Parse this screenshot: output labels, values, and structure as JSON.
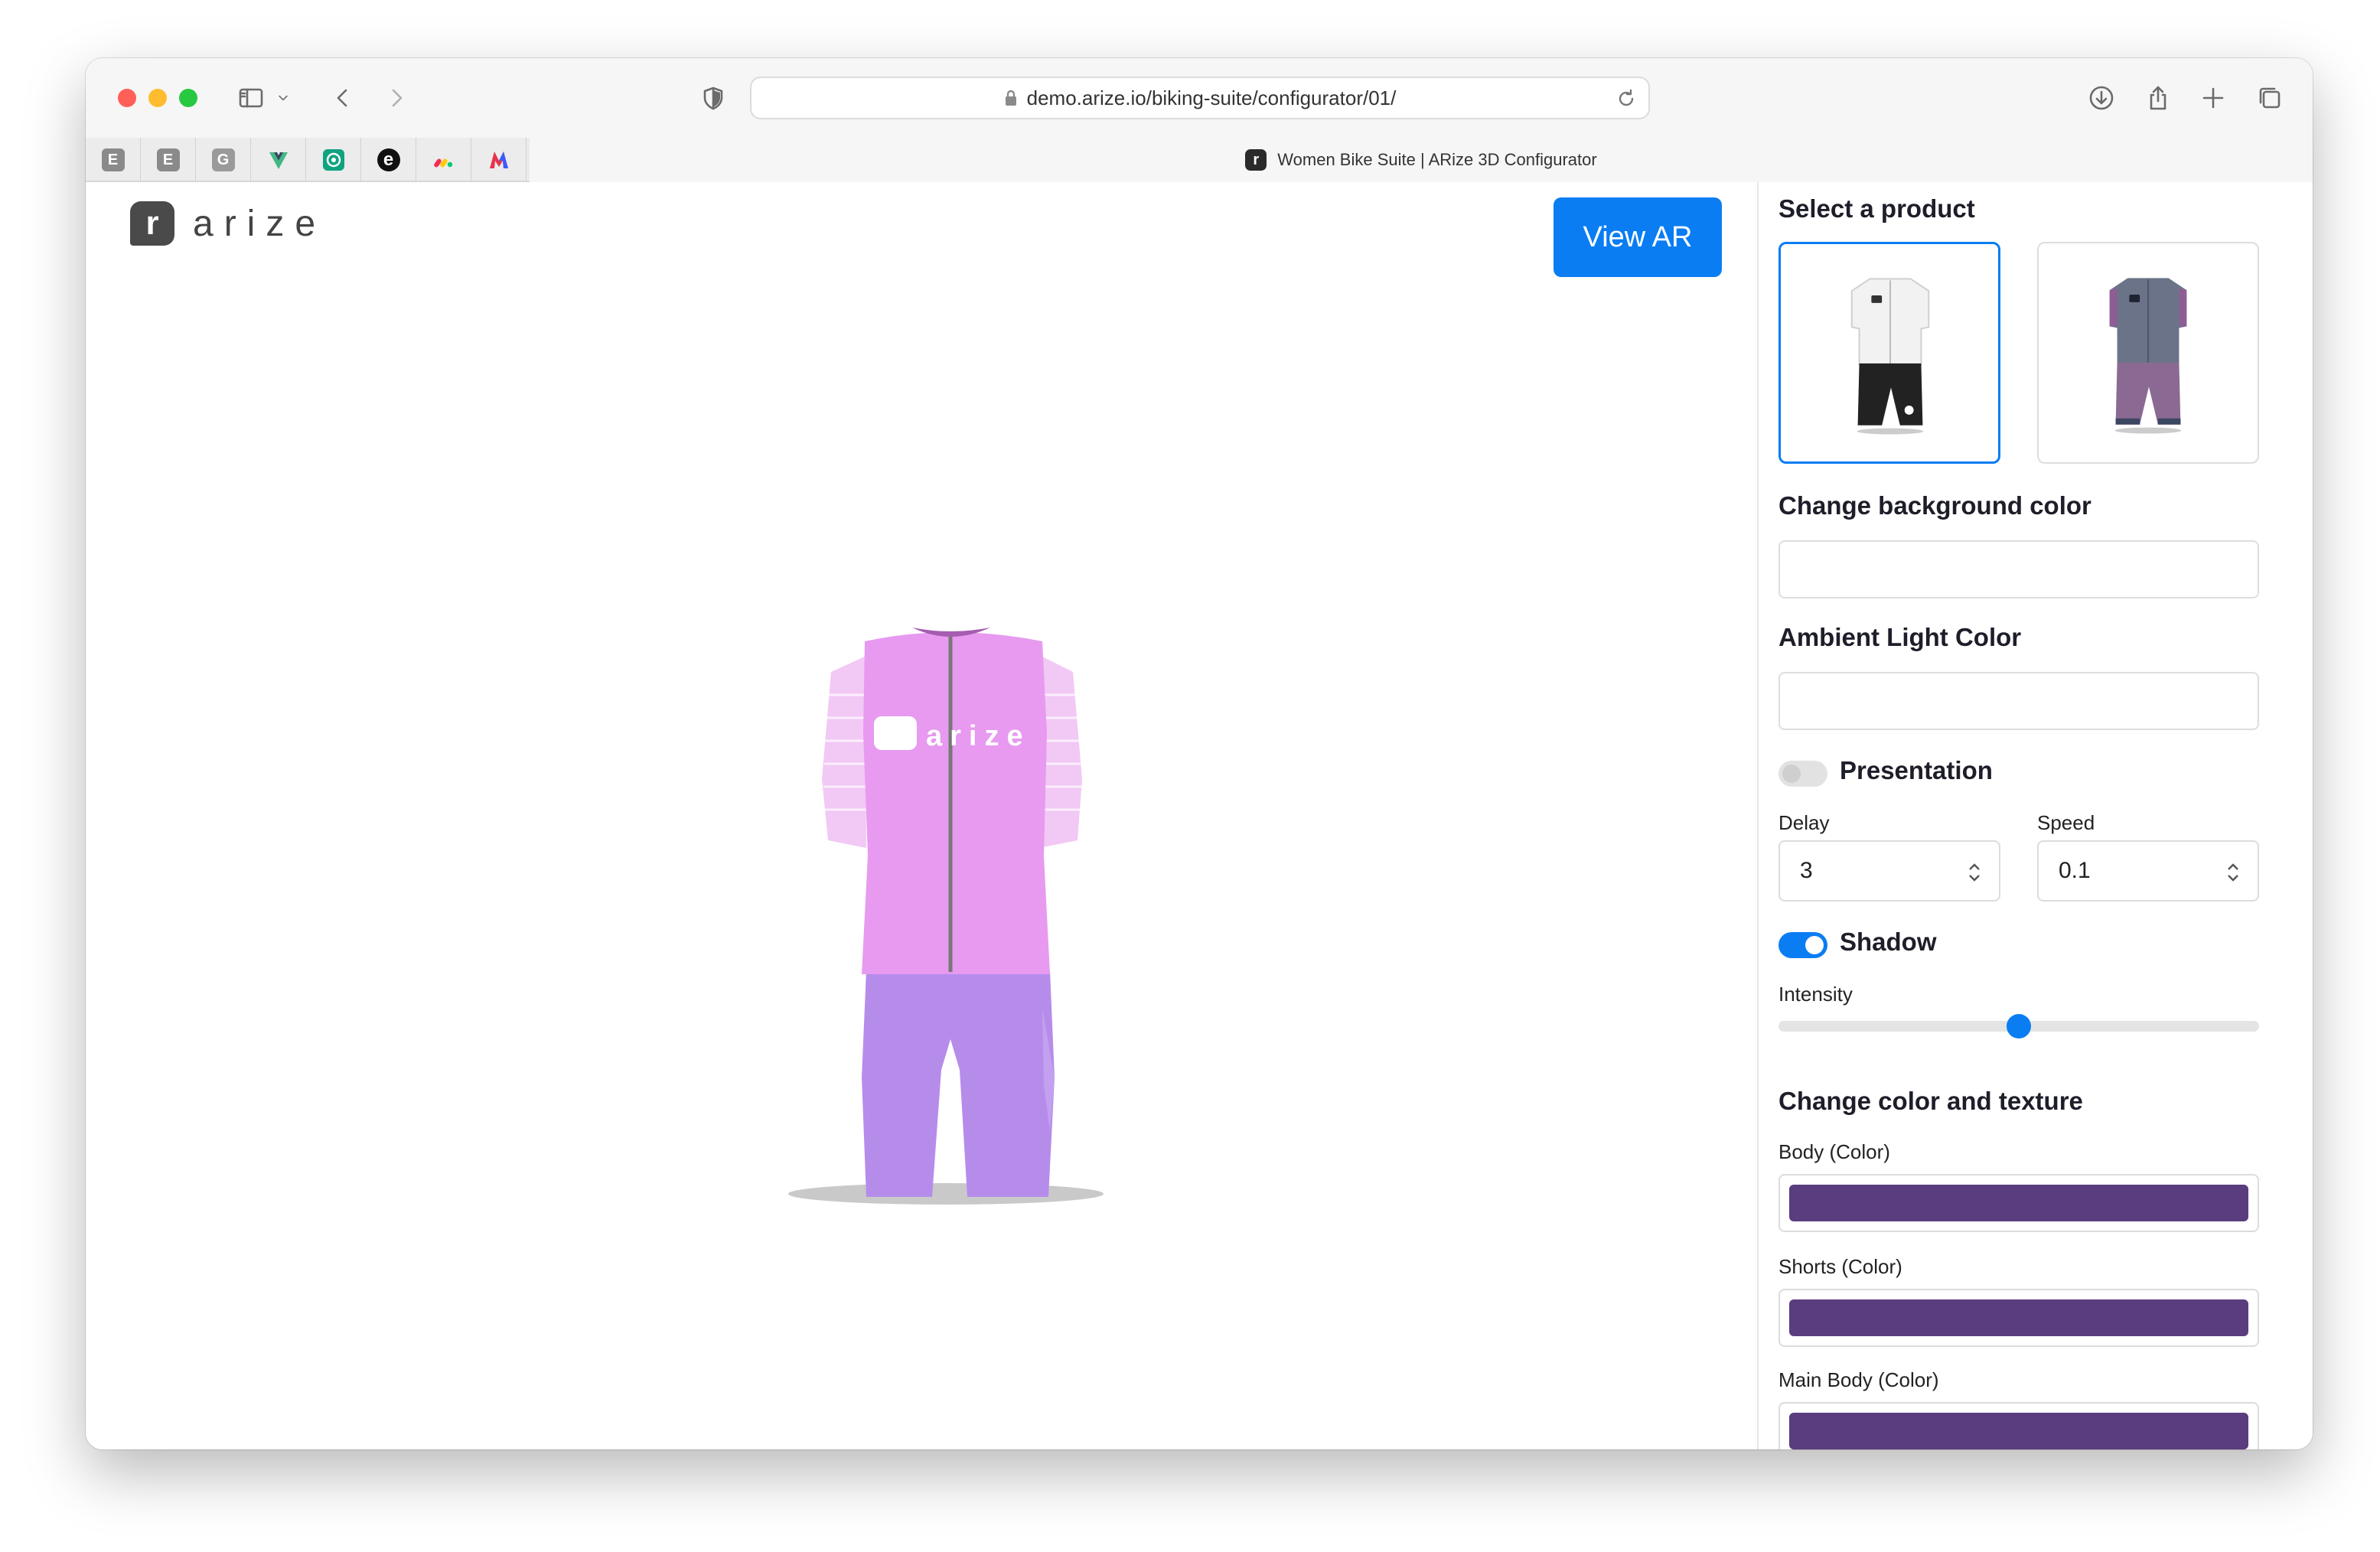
{
  "browser": {
    "url": "demo.arize.io/biking-suite/configurator/01/",
    "tab_title": "Women Bike Suite | ARize 3D Configurator",
    "pinned_tabs": [
      "E",
      "E",
      "G",
      "V",
      "openai",
      "e",
      "monday",
      "M"
    ],
    "tab_favicon_letter": "r"
  },
  "viewer": {
    "logo_letter": "r",
    "logo_text": "arize",
    "view_ar_label": "View AR",
    "jersey_logo_text": "arize"
  },
  "panel": {
    "select_product_title": "Select a product",
    "products": [
      {
        "name": "white-black-suit",
        "selected": true
      },
      {
        "name": "grey-purple-suit",
        "selected": false
      }
    ],
    "background_color_title": "Change background color",
    "ambient_light_title": "Ambient Light Color",
    "presentation_label": "Presentation",
    "presentation_on": false,
    "delay_label": "Delay",
    "delay_value": "3",
    "speed_label": "Speed",
    "speed_value": "0.1",
    "shadow_label": "Shadow",
    "shadow_on": true,
    "intensity_label": "Intensity",
    "intensity_value": 0.5,
    "texture_title": "Change color and texture",
    "body_color_label": "Body (Color)",
    "shorts_color_label": "Shorts (Color)",
    "main_body_color_label": "Main Body (Color)",
    "swatch_color": "#5a3d7e"
  },
  "colors": {
    "accent": "#0a7df3",
    "jersey": "#e79af0",
    "shorts": "#b68ceb"
  }
}
